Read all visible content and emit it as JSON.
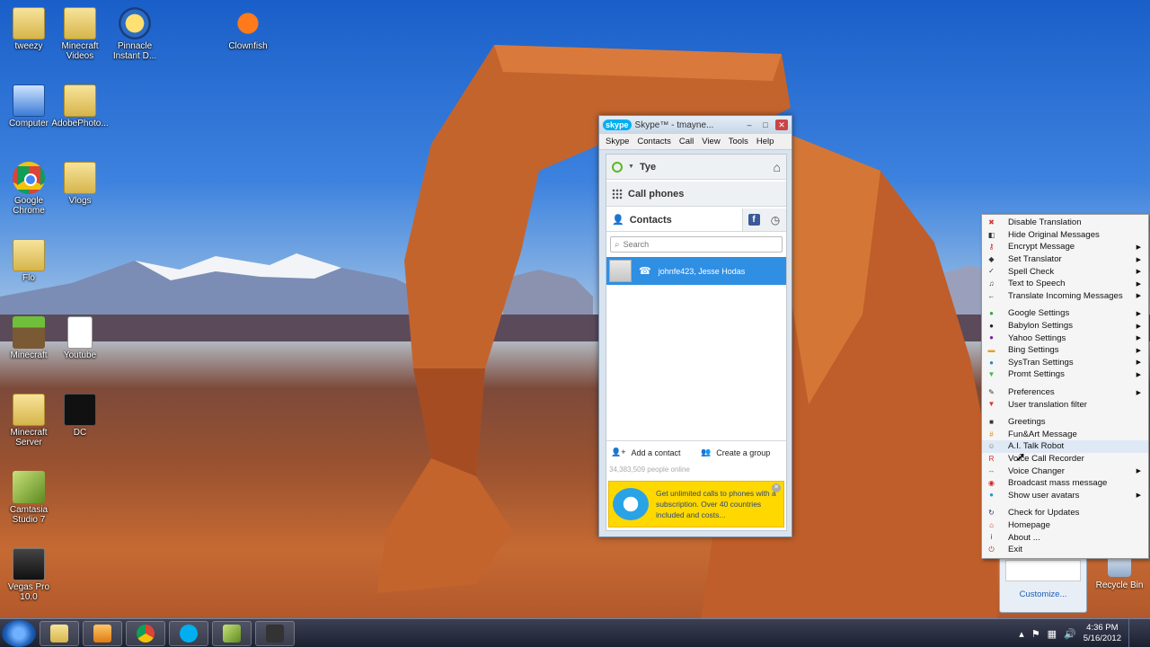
{
  "desktop_icons": [
    {
      "name": "tweezy",
      "kind": "folder"
    },
    {
      "name": "Minecraft Videos",
      "kind": "folder"
    },
    {
      "name": "Pinnacle Instant D...",
      "kind": "pinnacle"
    },
    {
      "name": "Clownfish",
      "kind": "fish"
    },
    {
      "name": "Computer",
      "kind": "computer"
    },
    {
      "name": "AdobePhoto...",
      "kind": "folder"
    },
    {
      "name": "Google Chrome",
      "kind": "chrome"
    },
    {
      "name": "Vlogs",
      "kind": "folder"
    },
    {
      "name": "Flo",
      "kind": "folder"
    },
    {
      "name": "Minecraft",
      "kind": "grass"
    },
    {
      "name": "Youtube",
      "kind": "document"
    },
    {
      "name": "Minecraft Server",
      "kind": "folder"
    },
    {
      "name": "DC",
      "kind": "dark"
    },
    {
      "name": "Camtasia Studio 7",
      "kind": "camtasia"
    },
    {
      "name": "Vegas Pro 10.0",
      "kind": "vegas"
    }
  ],
  "skype": {
    "window_title": "Skype™ - tmayne...",
    "logo": "skype",
    "menu": [
      "Skype",
      "Contacts",
      "Call",
      "View",
      "Tools",
      "Help"
    ],
    "profile_name": "Tye",
    "call_phones": "Call phones",
    "contacts_tab": "Contacts",
    "search_placeholder": "Search",
    "contact_entry": "johnfe423, Jesse Hodas",
    "add_contact": "Add a contact",
    "create_group": "Create a group",
    "people_online": "34,383,509 people online",
    "ad_text": "Get unlimited calls to phones with a subscription. Over 40 countries included and costs..."
  },
  "context_menu": {
    "groups": [
      [
        {
          "label": "Disable Translation",
          "icon": "translate-off-icon",
          "submenu": false
        },
        {
          "label": "Hide Original Messages",
          "icon": "hide-icon",
          "submenu": false
        },
        {
          "label": "Encrypt Message",
          "icon": "key-icon",
          "submenu": true
        },
        {
          "label": "Set Translator",
          "icon": "translator-icon",
          "submenu": true
        },
        {
          "label": "Spell Check",
          "icon": "spellcheck-icon",
          "submenu": true
        },
        {
          "label": "Text to Speech",
          "icon": "speech-icon",
          "submenu": true
        },
        {
          "label": "Translate Incoming Messages",
          "icon": "incoming-icon",
          "submenu": true
        }
      ],
      [
        {
          "label": "Google Settings",
          "icon": "google-icon",
          "submenu": true
        },
        {
          "label": "Babylon Settings",
          "icon": "babylon-icon",
          "submenu": true
        },
        {
          "label": "Yahoo Settings",
          "icon": "yahoo-icon",
          "submenu": true
        },
        {
          "label": "Bing Settings",
          "icon": "bing-icon",
          "submenu": true
        },
        {
          "label": "SysTran Settings",
          "icon": "systran-icon",
          "submenu": true
        },
        {
          "label": "Promt Settings",
          "icon": "promt-icon",
          "submenu": true
        }
      ],
      [
        {
          "label": "Preferences",
          "icon": "wrench-icon",
          "submenu": true
        },
        {
          "label": "User translation filter",
          "icon": "filter-icon",
          "submenu": false
        }
      ],
      [
        {
          "label": "Greetings",
          "icon": "greetings-icon",
          "submenu": false
        },
        {
          "label": "Fun&Art Message",
          "icon": "funart-icon",
          "submenu": false
        },
        {
          "label": "A.I. Talk Robot",
          "icon": "robot-icon",
          "submenu": false,
          "highlighted": true
        },
        {
          "label": "Voice Call Recorder",
          "icon": "recorder-icon",
          "submenu": false
        },
        {
          "label": "Voice Changer",
          "icon": "voice-changer-icon",
          "submenu": true
        },
        {
          "label": "Broadcast mass message",
          "icon": "broadcast-icon",
          "submenu": false
        },
        {
          "label": "Show user avatars",
          "icon": "avatar-icon",
          "submenu": true
        }
      ],
      [
        {
          "label": "Check for Updates",
          "icon": "update-icon",
          "submenu": false
        },
        {
          "label": "Homepage",
          "icon": "home-icon",
          "submenu": false
        },
        {
          "label": "About ...",
          "icon": "info-icon",
          "submenu": false
        },
        {
          "label": "Exit",
          "icon": "exit-icon",
          "submenu": false
        }
      ]
    ]
  },
  "tray_popup": {
    "customize": "Customize..."
  },
  "recycle_bin": "Recycle Bin",
  "taskbar": {
    "apps": [
      "windows-explorer",
      "media-player",
      "google-chrome",
      "skype",
      "camtasia",
      "camera"
    ],
    "time": "4:36 PM",
    "date": "5/16/2012"
  },
  "colors": {
    "skype_blue": "#00aff0",
    "selection_blue": "#2e8fe3",
    "ad_yellow": "#ffd800"
  }
}
